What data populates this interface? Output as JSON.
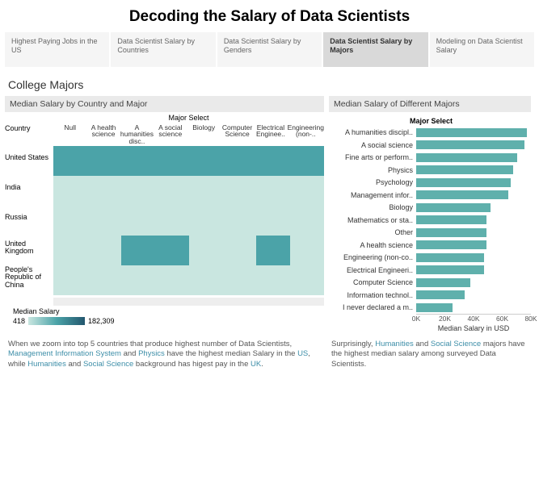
{
  "title": "Decoding the Salary of Data Scientists",
  "tabs": [
    {
      "label": "Highest Paying Jobs in the US",
      "active": false
    },
    {
      "label": "Data Scientist Salary by Countries",
      "active": false
    },
    {
      "label": "Data Scientist Salary by Genders",
      "active": false
    },
    {
      "label": "Data Scientist Salary by Majors",
      "active": true
    },
    {
      "label": "Modeling on Data Scientist Salary",
      "active": false
    }
  ],
  "section_title": "College Majors",
  "left_panel_title": "Median Salary by Country and Major",
  "right_panel_title": "Median Salary of Different Majors",
  "major_header": "Major Select",
  "country_header": "Country",
  "majors": [
    "Null",
    "A health science",
    "A humanities disc..",
    "A social science",
    "Biology",
    "Computer Science",
    "Electrical Enginee..",
    "Engineering (non-.."
  ],
  "countries": [
    "United States",
    "India",
    "Russia",
    "United Kingdom",
    "People's Republic of China"
  ],
  "legend_label": "Median Salary",
  "legend_min": "418",
  "legend_max": "182,309",
  "chart_data": {
    "type": "bar",
    "title": "Major Select",
    "xlabel": "Median Salary in USD",
    "xlim": [
      0,
      85000
    ],
    "ticks": [
      "0K",
      "20K",
      "40K",
      "60K",
      "80K"
    ],
    "categories": [
      "A humanities discipl..",
      "A social science",
      "Fine arts or perform..",
      "Physics",
      "Psychology",
      "Management infor..",
      "Biology",
      "Mathematics or sta..",
      "Other",
      "A health science",
      "Engineering (non-co..",
      "Electrical Engineeri..",
      "Computer Science",
      "Information technol..",
      "I never declared a m.."
    ],
    "values": [
      82000,
      80000,
      75000,
      72000,
      70000,
      68000,
      55000,
      52000,
      52000,
      52000,
      50000,
      50000,
      40000,
      36000,
      27000
    ]
  },
  "footer_left_parts": {
    "p1": "When we zoom into top 5 countries that produce highest number of Data Scientists, ",
    "a1": "Management Information System",
    "p2": " and ",
    "a2": "Physics",
    "p3": " have the highest median Salary in the ",
    "a3": "US",
    "p4": ", while ",
    "a4": "Humanities",
    "p5": " and ",
    "a5": "Social Science",
    "p6": " background has higest pay in the ",
    "a6": "UK",
    "p7": "."
  },
  "footer_right_parts": {
    "p1": "Surprisingly, ",
    "a1": "Humanities",
    "p2": " and ",
    "a2": "Social Science",
    "p3": " majors have the highest median salary among surveyed Data Scientists."
  },
  "heatmap_dark": {
    "United Kingdom": [
      2,
      3,
      6
    ]
  }
}
